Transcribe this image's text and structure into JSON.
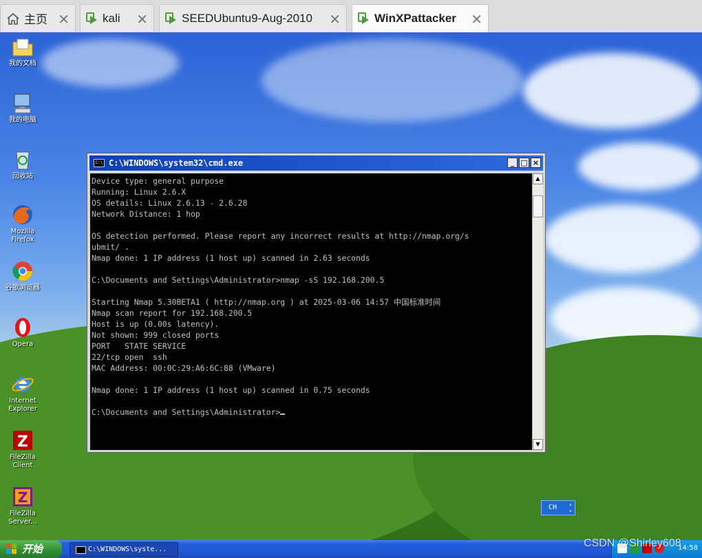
{
  "tabs": [
    {
      "label": "主页",
      "icon": "home-icon",
      "active": false
    },
    {
      "label": "kali",
      "icon": "vm-icon",
      "active": false
    },
    {
      "label": "SEEDUbuntu9-Aug-2010",
      "icon": "vm-icon",
      "active": false
    },
    {
      "label": "WinXPattacker",
      "icon": "vm-icon",
      "active": true
    }
  ],
  "desktop_icons": [
    {
      "label": "我的文档",
      "icon": "my-documents-icon"
    },
    {
      "label": "我的电脑",
      "icon": "my-computer-icon"
    },
    {
      "label": "回收站",
      "icon": "recycle-bin-icon"
    },
    {
      "label": "Mozilla Firefox",
      "icon": "firefox-icon"
    },
    {
      "label": "谷歌浏览器",
      "icon": "chrome-icon"
    },
    {
      "label": "Opera",
      "icon": "opera-icon"
    },
    {
      "label": "Internet Explorer",
      "icon": "internet-explorer-icon"
    },
    {
      "label": "FileZilla Client",
      "icon": "filezilla-client-icon"
    },
    {
      "label": "FileZilla Server...",
      "icon": "filezilla-server-icon"
    }
  ],
  "cmd_window": {
    "title": "C:\\WINDOWS\\system32\\cmd.exe",
    "icon_text": "C:\\",
    "minimize": "_",
    "maximize": "□",
    "close": "×",
    "lines": [
      "Device type: general purpose",
      "Running: Linux 2.6.X",
      "OS details: Linux 2.6.13 - 2.6.28",
      "Network Distance: 1 hop",
      "",
      "OS detection performed. Please report any incorrect results at http://nmap.org/s",
      "ubmit/ .",
      "Nmap done: 1 IP address (1 host up) scanned in 2.63 seconds",
      "",
      "C:\\Documents and Settings\\Administrator>nmap -sS 192.168.200.5",
      "",
      "Starting Nmap 5.30BETA1 ( http://nmap.org ) at 2025-03-06 14:57 中国标准时间",
      "Nmap scan report for 192.168.200.5",
      "Host is up (0.00s latency).",
      "Not shown: 999 closed ports",
      "PORT   STATE SERVICE",
      "22/tcp open  ssh",
      "MAC Address: 00:0C:29:A6:6C:88 (VMware)",
      "",
      "Nmap done: 1 IP address (1 host up) scanned in 0.75 seconds",
      "",
      "C:\\Documents and Settings\\Administrator>"
    ]
  },
  "language_bar": {
    "label": "CH"
  },
  "taskbar": {
    "start_label": "开始",
    "task_item": "C:\\WINDOWS\\syste...",
    "clock": "14:58"
  },
  "watermark": "CSDN @Shirley608",
  "colors": {
    "title_bar": "#0b3fb8",
    "console_bg": "#000000",
    "console_text": "#c0c0c0",
    "taskbar": "#245edb",
    "start_button": "#2f8d2f",
    "vm_icon": "#4f9a3b"
  }
}
